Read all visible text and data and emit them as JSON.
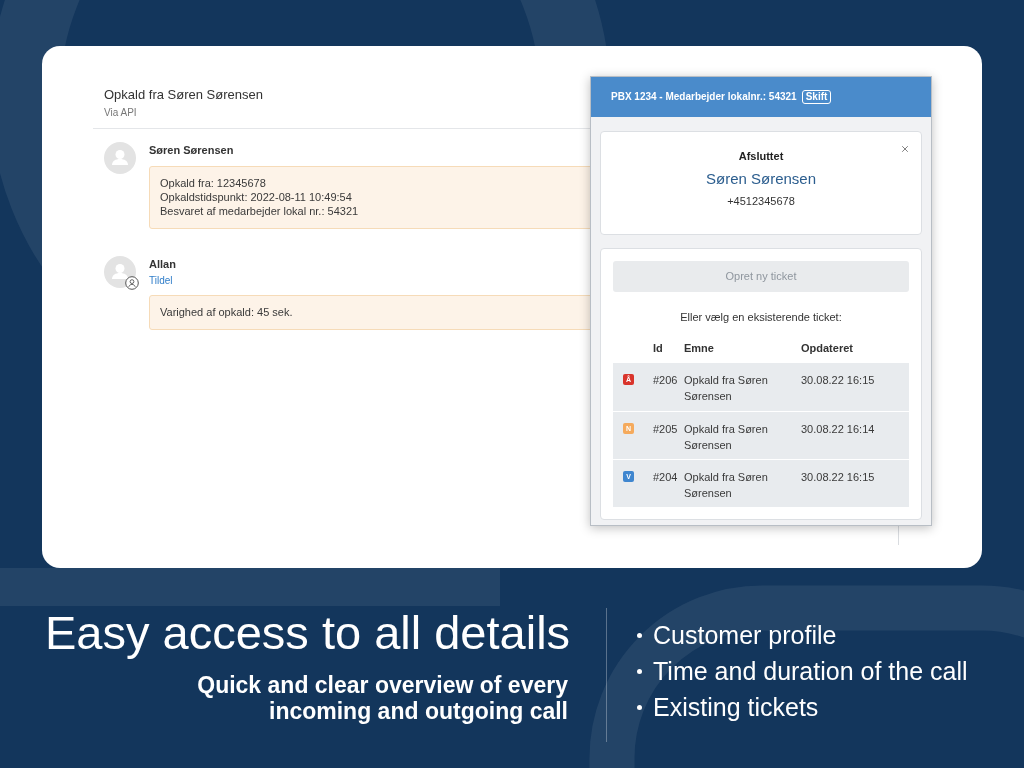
{
  "conversation": {
    "title": "Opkald fra Søren Sørensen",
    "subtitle": "Via API",
    "messages": [
      {
        "author": "Søren Sørensen",
        "agent": false,
        "lines": [
          "Opkald fra: 12345678",
          "Opkaldstidspunkt: 2022-08-11 10:49:54",
          "Besvaret af medarbejder lokal nr.: 54321"
        ]
      },
      {
        "author": "Allan",
        "agent": true,
        "link": "Tildel",
        "lines": [
          "Varighed af opkald: 45 sek."
        ]
      }
    ]
  },
  "phone_panel": {
    "header": "PBX 1234 - Medarbejder lokalnr.: 54321",
    "switch_button": "Skift",
    "call": {
      "status": "Afsluttet",
      "name": "Søren Sørensen",
      "number": "+4512345678"
    },
    "tickets": {
      "create_button": "Opret ny ticket",
      "create_disabled": true,
      "prompt": "Eller vælg en eksisterende ticket:",
      "columns": [
        "Id",
        "Emne",
        "Opdateret"
      ],
      "rows": [
        {
          "status": "Å",
          "color": "#d9342b",
          "id": "#206",
          "subject": "Opkald fra Søren Sørensen",
          "updated": "30.08.22 16:15"
        },
        {
          "status": "N",
          "color": "#f5aa5c",
          "id": "#205",
          "subject": "Opkald fra Søren Sørensen",
          "updated": "30.08.22 16:14"
        },
        {
          "status": "V",
          "color": "#3f86cf",
          "id": "#204",
          "subject": "Opkald fra Søren Sørensen",
          "updated": "30.08.22 16:15"
        }
      ]
    }
  },
  "promo": {
    "heading": "Easy access to all details",
    "subheading": "Quick and clear overview of every incoming and outgoing call",
    "bullets": [
      "Customer profile",
      "Time and duration of the call",
      "Existing tickets"
    ]
  }
}
